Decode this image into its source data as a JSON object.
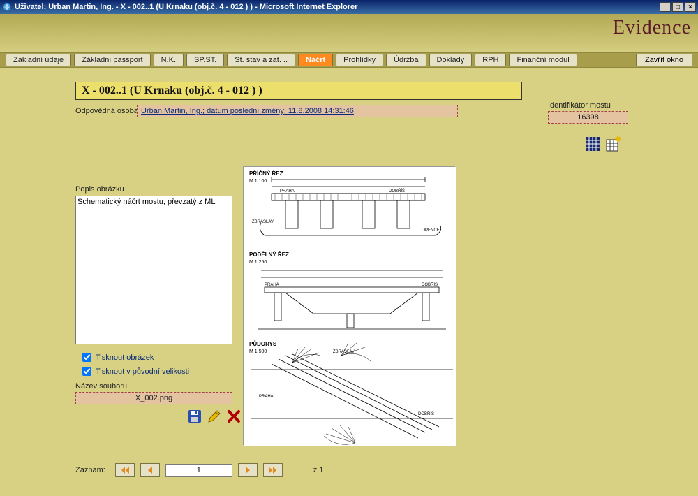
{
  "window": {
    "title": "Uživatel: Urban Martin, Ing. - X - 002..1 (U Krnaku (obj.č. 4 - 012 ) ) - Microsoft Internet Explorer"
  },
  "brand": "Evidence",
  "tabs": [
    {
      "label": "Základní údaje",
      "active": false
    },
    {
      "label": "Základní passport",
      "active": false
    },
    {
      "label": "N.K.",
      "active": false
    },
    {
      "label": "SP.ST.",
      "active": false
    },
    {
      "label": "St. stav a zat. ..",
      "active": false
    },
    {
      "label": "Náčrt",
      "active": true
    },
    {
      "label": "Prohlídky",
      "active": false
    },
    {
      "label": "Údržba",
      "active": false
    },
    {
      "label": "Doklady",
      "active": false
    },
    {
      "label": "RPH",
      "active": false
    },
    {
      "label": "Finanční modul",
      "active": false
    }
  ],
  "close_button": "Zavřít okno",
  "heading": "X - 002..1 (U Krnaku (obj.č. 4 - 012 ) )",
  "responsible": {
    "label": "Odpovědná osoba",
    "value": "Urban Martin, Ing.; datum poslední změny: 11.8.2008 14:31:46"
  },
  "identifier": {
    "label": "Identifikátor mostu",
    "value": "16398"
  },
  "description": {
    "label": "Popis obrázku",
    "value": "Schematický náčrt mostu, převzatý z ML"
  },
  "checkboxes": {
    "print_image": "Tisknout obrázek",
    "print_original_size": "Tisknout v původní velikosti"
  },
  "file": {
    "label": "Název souboru",
    "value": "X_002.png"
  },
  "drawing": {
    "section1_title": "PŘÍČNÝ ŘEZ",
    "section1_scale": "M 1:100",
    "section2_title": "PODÉLNÝ ŘEZ",
    "section2_scale": "M 1:250",
    "section3_title": "PŮDORYS",
    "section3_scale": "M 1:500",
    "label_praha": "PRAHA",
    "label_dobris": "DOBŘÍŠ",
    "label_zbraslav": "ZBRASLAV",
    "label_dobris2": "DOBŘÍŠ",
    "label_lipence": "LIPENCE"
  },
  "record": {
    "label": "Záznam:",
    "current": "1",
    "total": "z 1"
  }
}
